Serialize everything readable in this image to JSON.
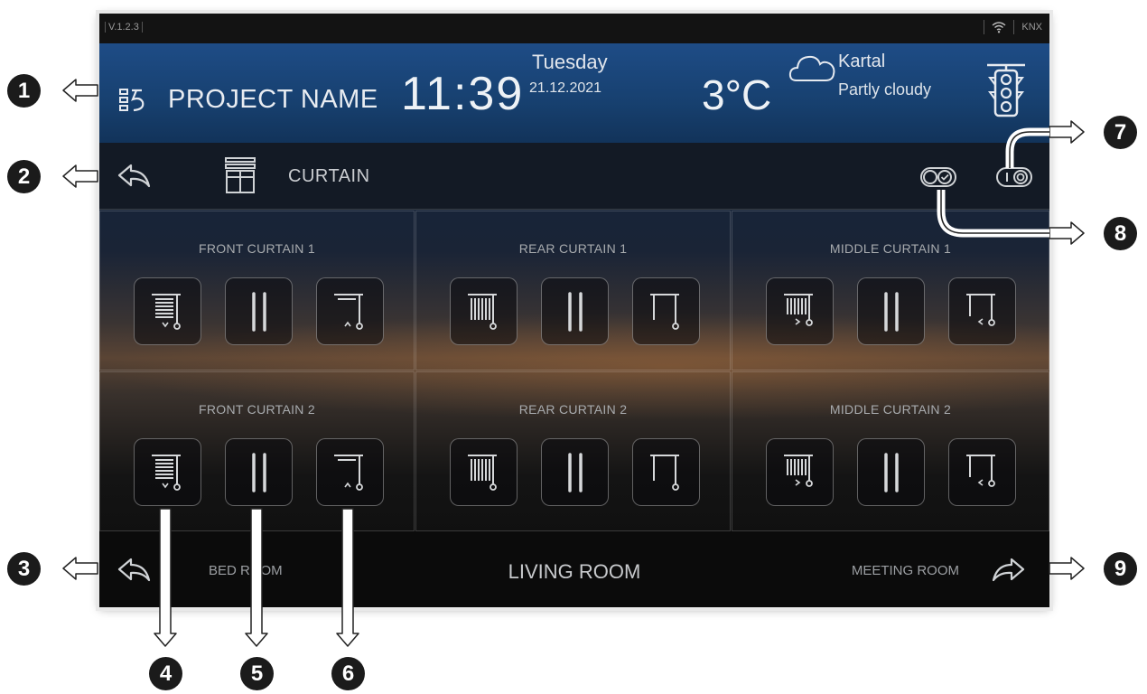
{
  "status_bar": {
    "version": "V.1.2.3",
    "protocol": "KNX"
  },
  "header": {
    "project_name": "PROJECT NAME",
    "time": "11:39",
    "day": "Tuesday",
    "date": "21.12.2021",
    "temperature": "3°C",
    "city": "Kartal",
    "weather": "Partly cloudy"
  },
  "toolbar": {
    "title": "CURTAIN"
  },
  "curtains": [
    {
      "title": "FRONT CURTAIN 1"
    },
    {
      "title": "REAR CURTAIN 1"
    },
    {
      "title": "MIDDLE CURTAIN 1"
    },
    {
      "title": "FRONT CURTAIN 2"
    },
    {
      "title": "REAR CURTAIN 2"
    },
    {
      "title": "MIDDLE CURTAIN 2"
    }
  ],
  "footer": {
    "prev_room": "BED ROOM",
    "current_room": "LIVING ROOM",
    "next_room": "MEETING ROOM"
  },
  "callouts": [
    "1",
    "2",
    "3",
    "4",
    "5",
    "6",
    "7",
    "8",
    "9"
  ],
  "colors": {
    "header_blue": "#1e4c86",
    "panel_dark": "#131313",
    "callout": "#1b1b1b"
  }
}
